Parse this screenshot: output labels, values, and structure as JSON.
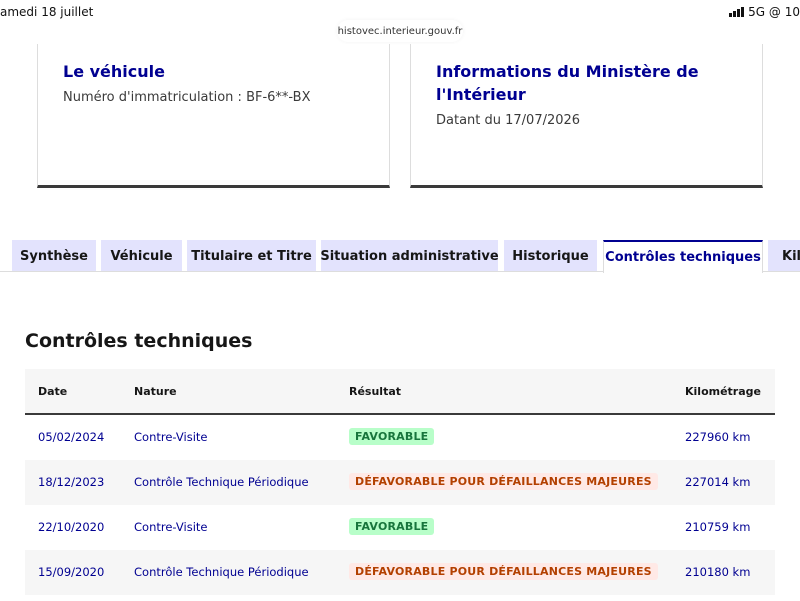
{
  "status_bar": {
    "date": "amedi 18 juillet",
    "network": "5G @ 10"
  },
  "url": "histovec.interieur.gouv.fr",
  "cards": {
    "vehicle": {
      "title": "Le véhicule",
      "text": "Numéro d'immatriculation : BF-6**-BX"
    },
    "ministry": {
      "title": "Informations du Ministère de l'Intérieur",
      "text": "Datant du 17/07/2026"
    }
  },
  "tabs": [
    {
      "label": "Synthèse"
    },
    {
      "label": "Véhicule"
    },
    {
      "label": "Titulaire et Titre"
    },
    {
      "label": "Situation administrative"
    },
    {
      "label": "Historique"
    },
    {
      "label": "Contrôles techniques",
      "active": true
    },
    {
      "label": "Kil"
    }
  ],
  "section": {
    "title": "Contrôles techniques"
  },
  "table": {
    "headers": {
      "date": "Date",
      "nature": "Nature",
      "result": "Résultat",
      "km": "Kilométrage"
    },
    "rows": [
      {
        "date": "05/02/2024",
        "nature": "Contre-Visite",
        "result": "FAVORABLE",
        "status": "ok",
        "km": "227960 km"
      },
      {
        "date": "18/12/2023",
        "nature": "Contrôle Technique Périodique",
        "result": "DÉFAVORABLE POUR DÉFAILLANCES MAJEURES",
        "status": "ko",
        "km": "227014 km"
      },
      {
        "date": "22/10/2020",
        "nature": "Contre-Visite",
        "result": "FAVORABLE",
        "status": "ok",
        "km": "210759 km"
      },
      {
        "date": "15/09/2020",
        "nature": "Contrôle Technique Périodique",
        "result": "DÉFAVORABLE POUR DÉFAILLANCES MAJEURES",
        "status": "ko",
        "km": "210180 km"
      }
    ]
  },
  "colors": {
    "accent": "#000091",
    "tab_bg": "#e3e3fd",
    "success_bg": "#b8fec9",
    "success_text": "#18753c",
    "error_bg": "#ffe9e6",
    "error_text": "#b34000"
  }
}
